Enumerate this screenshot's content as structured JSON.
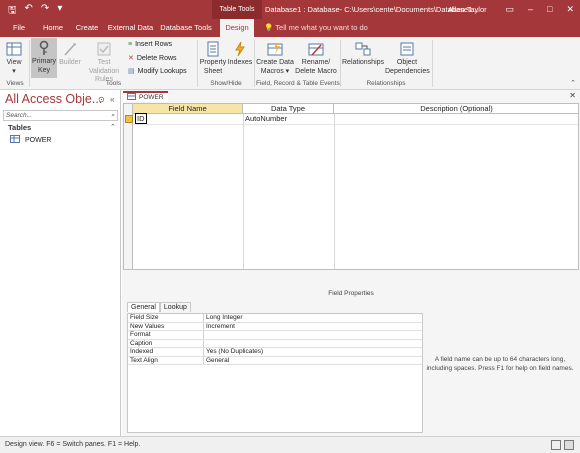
{
  "titlebar": {
    "context_tab": "Table Tools",
    "title": "Database1 : Database- C:\\Users\\cente\\Documents\\Database1...",
    "user": "Allen Taylor"
  },
  "tabs": [
    "File",
    "Home",
    "Create",
    "External Data",
    "Database Tools",
    "Design"
  ],
  "active_tab": "Design",
  "tell_me": "Tell me what you want to do",
  "ribbon": {
    "view": "View",
    "primary_key": [
      "Primary",
      "Key"
    ],
    "builder": "Builder",
    "test_validation": [
      "Test Validation",
      "Rules"
    ],
    "insert_rows": "Insert Rows",
    "delete_rows": "Delete Rows",
    "modify_lookups": "Modify Lookups",
    "property_sheet": [
      "Property",
      "Sheet"
    ],
    "indexes": "Indexes",
    "create_data_macros": [
      "Create Data",
      "Macros"
    ],
    "rename_delete_macro": [
      "Rename/",
      "Delete Macro"
    ],
    "relationships": "Relationships",
    "object_dependencies": [
      "Object",
      "Dependencies"
    ],
    "groups": {
      "views": "Views",
      "tools": "Tools",
      "show_hide": "Show/Hide",
      "field_record_table_events": "Field, Record & Table Events",
      "relationships": "Relationships"
    }
  },
  "nav": {
    "title": "All Access Obje...",
    "search_placeholder": "Search...",
    "group": "Tables",
    "items": [
      "POWER"
    ]
  },
  "document": {
    "tab": "POWER",
    "columns": [
      "Field Name",
      "Data Type",
      "Description (Optional)"
    ],
    "rows": [
      {
        "field_name": "ID",
        "data_type": "AutoNumber",
        "description": ""
      }
    ]
  },
  "field_properties": {
    "label": "Field Properties",
    "tabs": [
      "General",
      "Lookup"
    ],
    "active_tab": "General",
    "rows": [
      {
        "key": "Field Size",
        "value": "Long Integer"
      },
      {
        "key": "New Values",
        "value": "Increment"
      },
      {
        "key": "Format",
        "value": ""
      },
      {
        "key": "Caption",
        "value": ""
      },
      {
        "key": "Indexed",
        "value": "Yes (No Duplicates)"
      },
      {
        "key": "Text Align",
        "value": "General"
      }
    ],
    "help": "A field name can be up to 64 characters long, including spaces. Press F1 for help on field names."
  },
  "statusbar": {
    "text": "Design view.  F6 = Switch panes.  F1 = Help."
  },
  "colors": {
    "accent": "#a4373a",
    "ribbon_bg": "#f3f3f3",
    "header_highlight": "#f5e6a6"
  }
}
